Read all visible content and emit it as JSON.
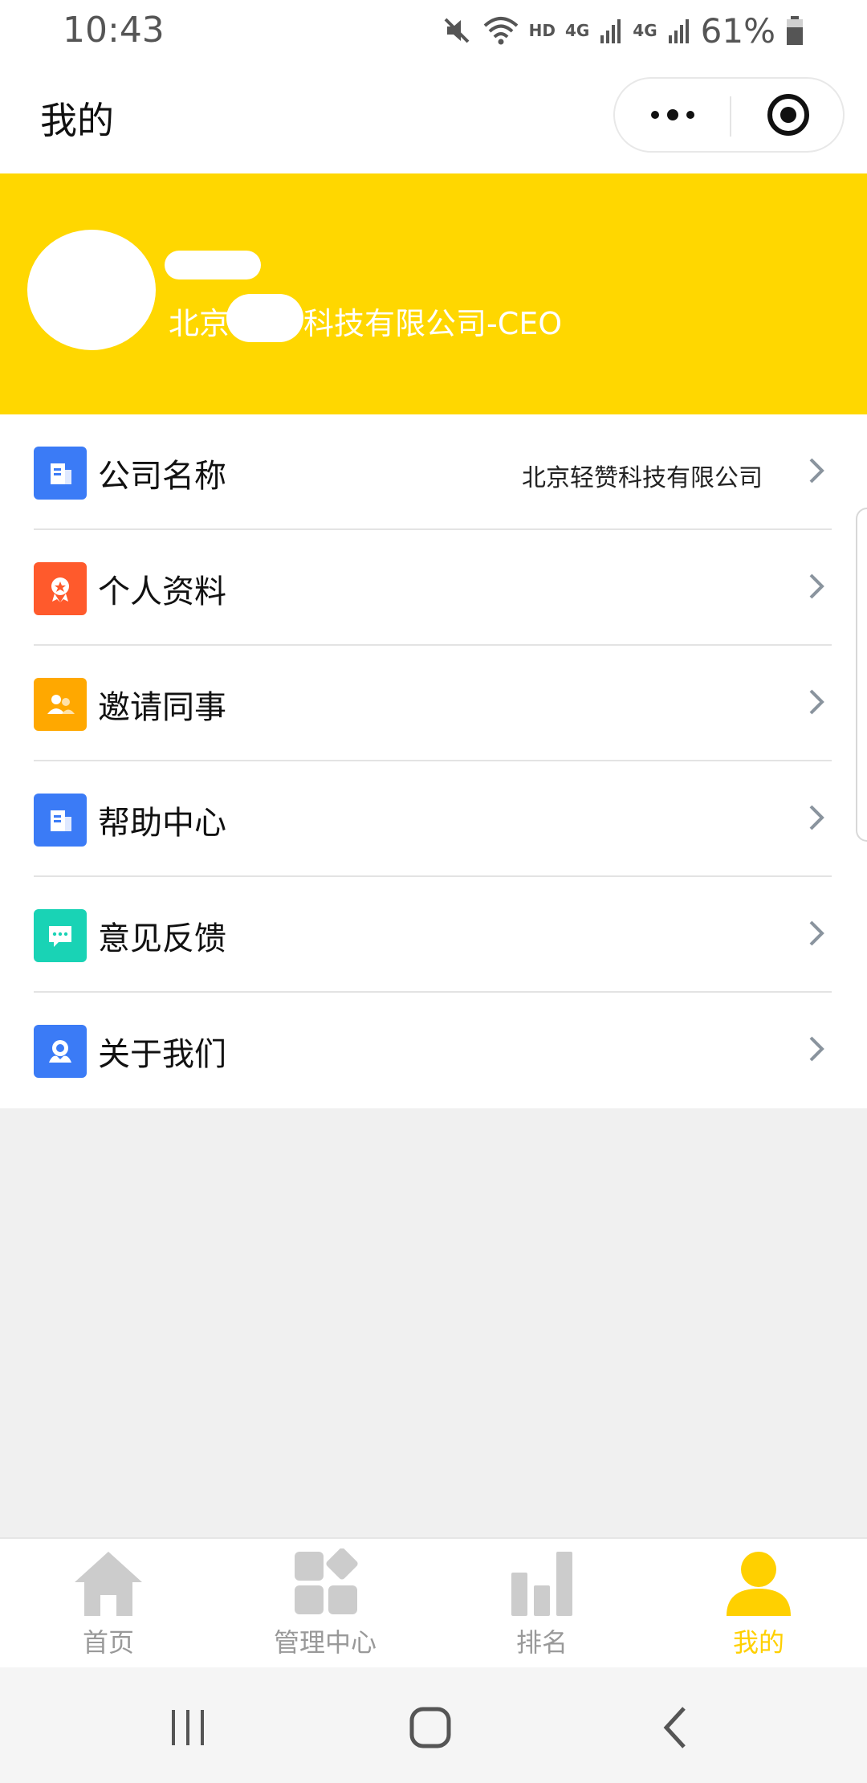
{
  "status_bar": {
    "time": "10:43",
    "network": "HD",
    "signal_1": "4G",
    "signal_2": "4G",
    "battery": "61%",
    "icons": [
      "mute-icon",
      "wifi-icon",
      "signal-icon",
      "battery-icon"
    ]
  },
  "nav": {
    "title": "我的",
    "more_icon": "more-dots-icon",
    "target_icon": "target-icon"
  },
  "profile": {
    "company_role": "北京",
    "company_role_suffix": "科技有限公司-CEO"
  },
  "menu": {
    "items": [
      {
        "label": "公司名称",
        "value": "北京轻赞科技有限公司",
        "icon": "building-icon",
        "color": "#3B7BF6"
      },
      {
        "label": "个人资料",
        "value": "",
        "icon": "badge-icon",
        "color": "#FF5A2C"
      },
      {
        "label": "邀请同事",
        "value": "",
        "icon": "people-icon",
        "color": "#FFA800"
      },
      {
        "label": "帮助中心",
        "value": "",
        "icon": "building-icon",
        "color": "#3B7BF6"
      },
      {
        "label": "意见反馈",
        "value": "",
        "icon": "chat-icon",
        "color": "#19D3B5"
      },
      {
        "label": "关于我们",
        "value": "",
        "icon": "support-icon",
        "color": "#3B7BF6"
      }
    ]
  },
  "tabs": [
    {
      "label": "首页",
      "icon": "home-icon",
      "active": false
    },
    {
      "label": "管理中心",
      "icon": "grid-icon",
      "active": false
    },
    {
      "label": "排名",
      "icon": "bar-chart-icon",
      "active": false
    },
    {
      "label": "我的",
      "icon": "person-icon",
      "active": true
    }
  ],
  "colors": {
    "accent": "#FFD700",
    "tab_active": "#FFD000",
    "tab_inactive": "#999999",
    "background": "#F0F0F0"
  }
}
